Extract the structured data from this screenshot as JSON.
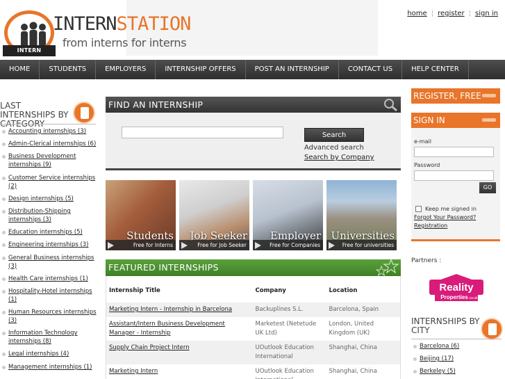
{
  "brand": {
    "name_part1": "INTERN",
    "name_part2": "STATION",
    "tagline": "from interns for interns",
    "badge": "INTERN STATION",
    "accent": "#e8752a"
  },
  "toplinks": [
    "home",
    "register",
    "sign in"
  ],
  "nav": [
    "HOME",
    "STUDENTS",
    "EMPLOYERS",
    "INTERNSHIP OFFERS",
    "POST AN INTERNSHIP",
    "CONTACT US",
    "HELP CENTER"
  ],
  "left": {
    "title": "LAST INTERNSHIPS BY CATEGORY",
    "icon": "note-icon",
    "categories": [
      "Accounting internships (3)",
      "Admin-Clerical internships (6)",
      "Business Development internships (9)",
      "Customer Service internships (2)",
      "Design internships (5)",
      "Distribution-Shipping internships (3)",
      "Education internships (5)",
      "Engineering internships (3)",
      "General Business internships (3)",
      "Health Care internships (1)",
      "Hospitality-Hotel internships (1)",
      "Human Resources internships (3)",
      "Information Technology internships (8)",
      "Legal internships (4)",
      "Management internships (1)"
    ]
  },
  "find": {
    "title": "FIND AN INTERNSHIP",
    "button": "Search",
    "advanced": "Advanced search",
    "by_company": "Search by Company"
  },
  "tiles": [
    {
      "title": "Students",
      "sub": "Free for Interns"
    },
    {
      "title": "Job Seeker",
      "sub": "Free for Job Seeker"
    },
    {
      "title": "Employer",
      "sub": "Free for Companies"
    },
    {
      "title": "Universities",
      "sub": "Free for universities"
    }
  ],
  "featured": {
    "title": "FEATURED INTERNSHIPS",
    "columns": [
      "Internship Title",
      "Company",
      "Location"
    ],
    "rows": [
      {
        "title": "Marketing Intern - Internship in Barcelona",
        "company": "Backuplines S.L.",
        "location": "Barcelona, Spain"
      },
      {
        "title": "Assistant/Intern Business Development Manager - Internship",
        "company": "Marketest (Netetude UK Ltd)",
        "location": "London, United Kingdom (UK)"
      },
      {
        "title": "Supply Chain Project Intern",
        "company": "UOutlook Education International",
        "location": "Shanghai, China"
      },
      {
        "title": "Marketing Intern",
        "company": "UOutlook Education International",
        "location": "Shanghai, China"
      }
    ]
  },
  "right": {
    "register": "REGISTER, FREE",
    "signin": {
      "title": "SIGN IN",
      "email_label": "e-mail",
      "password_label": "Password",
      "go": "GO",
      "keep": "Keep me signed in",
      "forgot": "Forgot Your Password?",
      "register": "Registration"
    },
    "partners_label": "Partners :",
    "partner_logo": {
      "line1": "Reality",
      "line2": "Properties",
      "suffix": ".co.uk"
    },
    "cities_title": "INTERNSHIPS BY CITY",
    "cities": [
      "Barcelona (6)",
      "Beijing (17)",
      "Berkeley (5)"
    ]
  }
}
